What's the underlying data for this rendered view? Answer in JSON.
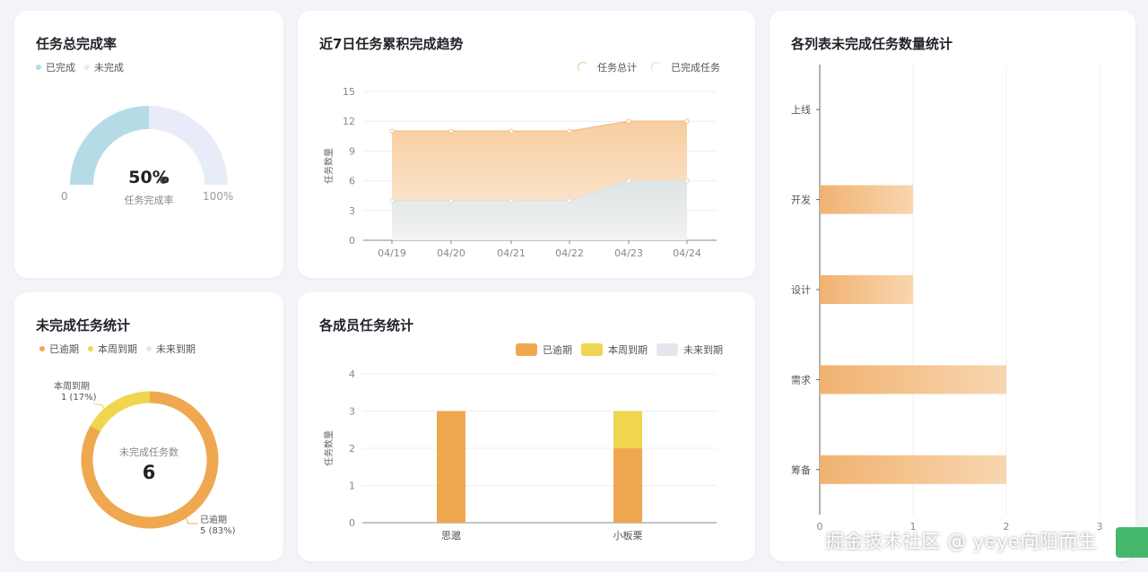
{
  "rate_card": {
    "title": "任务总完成率",
    "legend": [
      {
        "label": "已完成",
        "color": "#b5dbe7"
      },
      {
        "label": "未完成",
        "color": "#e8ecf8"
      }
    ],
    "center_value": "50%",
    "center_label": "任务完成率",
    "min_label": "0",
    "max_label": "100%"
  },
  "trend_card": {
    "title": "近7日任务累积完成趋势",
    "legend": [
      {
        "label": "任务总计",
        "color": "#f5c58f"
      },
      {
        "label": "已完成任务",
        "color": "#d8dee0"
      }
    ]
  },
  "list_card": {
    "title": "各列表未完成任务数量统计"
  },
  "unfinished_card": {
    "title": "未完成任务统计",
    "legend": [
      {
        "label": "已逾期",
        "color": "#efa850"
      },
      {
        "label": "本周到期",
        "color": "#f0d54e"
      },
      {
        "label": "未来到期",
        "color": "#e3e6ea"
      }
    ],
    "center_label": "未完成任务数",
    "center_value": "6",
    "label_week_name": "本周到期",
    "label_week_value": "1 (17%)",
    "label_overdue_name": "已逾期",
    "label_overdue_value": "5 (83%)"
  },
  "member_card": {
    "title": "各成员任务统计",
    "legend": [
      {
        "label": "已逾期",
        "color": "#efa850"
      },
      {
        "label": "本周到期",
        "color": "#f0d54e"
      },
      {
        "label": "未来到期",
        "color": "#e3e6ea"
      }
    ]
  },
  "watermark": {
    "text": "掘金技术社区 @ yeye向阳而生"
  },
  "chart_data": [
    {
      "type": "pie",
      "title": "任务总完成率",
      "categories": [
        "已完成",
        "未完成"
      ],
      "values": [
        50,
        50
      ]
    },
    {
      "type": "area",
      "title": "近7日任务累积完成趋势",
      "x": [
        "04/19",
        "04/20",
        "04/21",
        "04/22",
        "04/23",
        "04/24"
      ],
      "series": [
        {
          "name": "任务总计",
          "values": [
            11,
            11,
            11,
            11,
            12,
            12
          ]
        },
        {
          "name": "已完成任务",
          "values": [
            4,
            4,
            4,
            4,
            6,
            6
          ]
        }
      ],
      "ylabel": "任务数量",
      "ylim": [
        0,
        15
      ],
      "yticks": [
        0,
        3,
        6,
        9,
        12,
        15
      ],
      "grid": true,
      "legend": "top-right"
    },
    {
      "type": "bar",
      "orientation": "horizontal",
      "title": "各列表未完成任务数量统计",
      "categories": [
        "上线",
        "开发",
        "设计",
        "需求",
        "筹备"
      ],
      "values": [
        0,
        1,
        1,
        2,
        2
      ],
      "xlim": [
        0,
        3
      ],
      "xticks": [
        0,
        1,
        2,
        3
      ],
      "grid": true
    },
    {
      "type": "pie",
      "title": "未完成任务统计",
      "categories": [
        "已逾期",
        "本周到期",
        "未来到期"
      ],
      "values": [
        5,
        1,
        0
      ],
      "legend": "top-left"
    },
    {
      "type": "bar",
      "stacked": true,
      "title": "各成员任务统计",
      "categories": [
        "思邈",
        "小板栗"
      ],
      "series": [
        {
          "name": "已逾期",
          "values": [
            3,
            2
          ]
        },
        {
          "name": "本周到期",
          "values": [
            0,
            1
          ]
        },
        {
          "name": "未来到期",
          "values": [
            0,
            0
          ]
        }
      ],
      "ylabel": "任务数量",
      "ylim": [
        0,
        4
      ],
      "yticks": [
        0,
        1,
        2,
        3,
        4
      ],
      "grid": true,
      "legend": "top-right"
    }
  ]
}
